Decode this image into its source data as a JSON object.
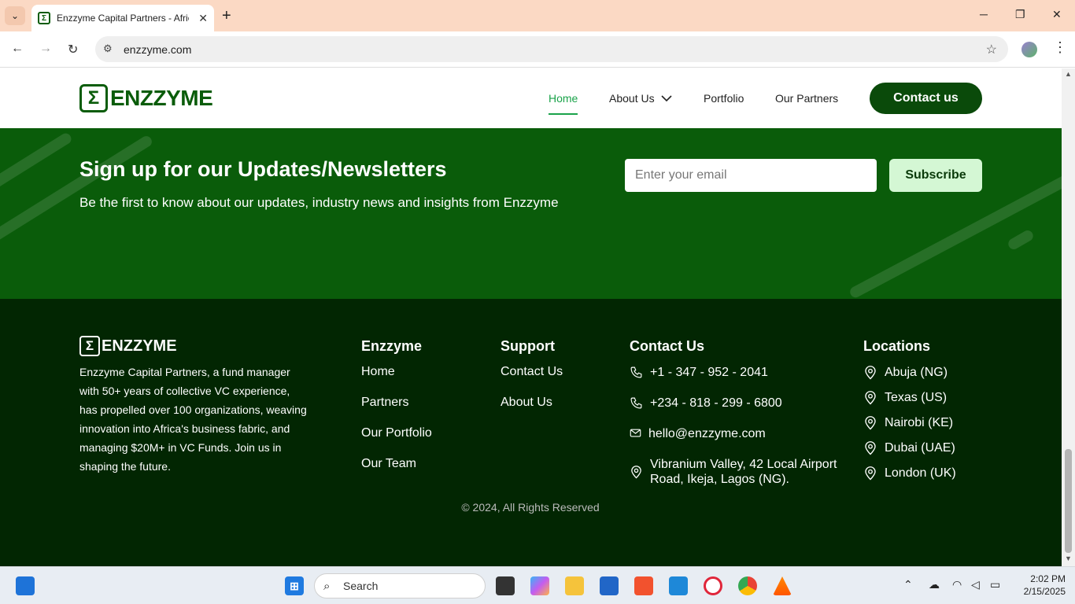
{
  "browser": {
    "tab_title": "Enzzyme Capital Partners - Africa",
    "tab_favicon_letter": "Σ",
    "url": "enzzyme.com"
  },
  "header": {
    "logo_symbol": "Σ",
    "logo_text": "ENZZYME",
    "nav": {
      "home": "Home",
      "about": "About Us",
      "portfolio": "Portfolio",
      "partners": "Our Partners"
    },
    "contact_button": "Contact us"
  },
  "newsletter": {
    "title": "Sign up for our Updates/Newsletters",
    "subtitle": "Be the first to know about our updates, industry news and insights from Enzzyme",
    "email_placeholder": "Enter your email",
    "subscribe_button": "Subscribe"
  },
  "footer": {
    "logo_symbol": "Σ",
    "logo_text": "ENZZYME",
    "description": "Enzzyme Capital Partners, a fund manager with 50+ years of collective VC experience, has propelled over 100 organizations, weaving innovation into Africa's business fabric, and managing $20M+ in VC Funds. Join us in shaping the future.",
    "enzzyme": {
      "heading": "Enzzyme",
      "links": [
        "Home",
        "Partners",
        "Our Portfolio",
        "Our Team"
      ]
    },
    "support": {
      "heading": "Support",
      "links": [
        "Contact Us",
        "About Us"
      ]
    },
    "contact": {
      "heading": "Contact Us",
      "phone1": "+1 - 347 - 952 - 2041",
      "phone2": "+234 - 818 - 299 - 6800",
      "email": "hello@enzzyme.com",
      "address": "Vibranium Valley, 42 Local Airport Road, Ikeja, Lagos (NG)."
    },
    "locations": {
      "heading": "Locations",
      "items": [
        "Abuja (NG)",
        "Texas (US)",
        "Nairobi (KE)",
        "Dubai (UAE)",
        "London (UK)"
      ]
    },
    "copyright": "© 2024, All Rights Reserved"
  },
  "taskbar": {
    "search_placeholder": "Search",
    "time": "2:02 PM",
    "date": "2/15/2025"
  },
  "colors": {
    "brand_green": "#0a5c0a",
    "nav_active": "#1aa34a",
    "footer_bg": "#022602",
    "subscribe_bg": "#d4f7d4"
  }
}
